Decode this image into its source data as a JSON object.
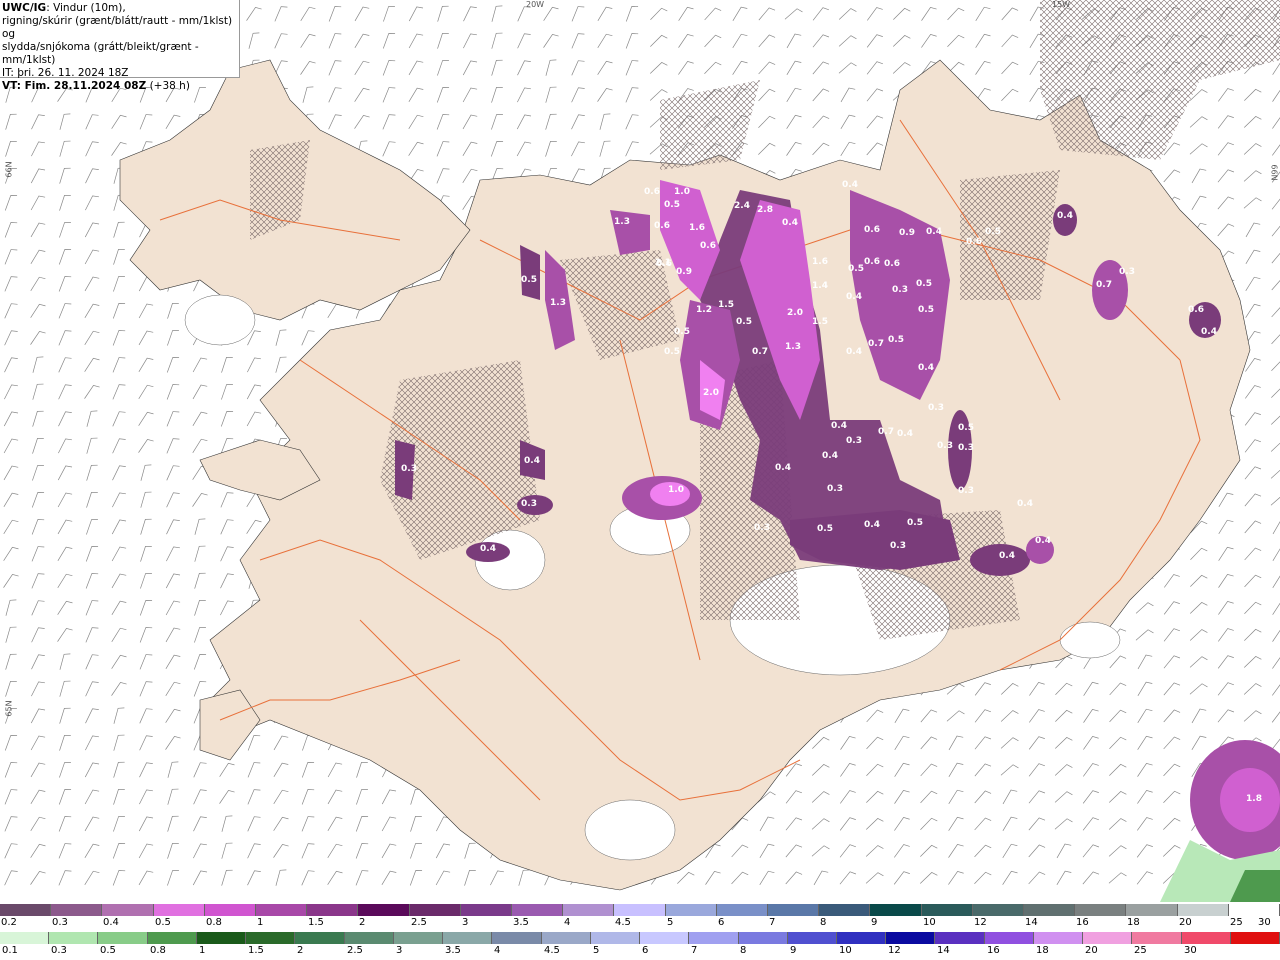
{
  "header": {
    "model": "UWC/IG",
    "line1": ": Vindur (10m),",
    "line2": "rigning/skúrir (grænt/blátt/rautt - mm/1klst) og",
    "line3": "slydda/snjókoma (grátt/bleikt/grænt - mm/1klst)",
    "it": "IT: þri. 26. 11. 2024 18Z",
    "vt_label": "VT: Fim. 28.11.2024 08Z",
    "vt_offset": " (+38 h)"
  },
  "grid_labels": {
    "lon_20w": "20W",
    "lon_15w": "15W",
    "lat_66n_left": "66N",
    "lat_66n_right": "66N",
    "lat_65n": "65N"
  },
  "map_values": [
    "0.6",
    "0.5",
    "1.3",
    "0.6",
    "1.0",
    "1.6",
    "0.6",
    "2.1",
    "0.9",
    "2.4",
    "2.8",
    "0.4",
    "0.4",
    "0.6",
    "0.9",
    "0.6",
    "0.5",
    "0.4",
    "1.6",
    "1.4",
    "0.5",
    "0.6",
    "0.6",
    "0.5",
    "0.3",
    "0.5",
    "1.3",
    "1.2",
    "1.5",
    "0.5",
    "2.0",
    "1.5",
    "0.4",
    "0.5",
    "0.5",
    "0.6",
    "0.4",
    "0.7",
    "0.5",
    "1.3",
    "0.7",
    "0.4",
    "0.5",
    "2.0",
    "0.5",
    "0.3",
    "0.4",
    "0.7",
    "0.4",
    "0.3",
    "0.4",
    "0.4",
    "0.3",
    "0.4",
    "0.3",
    "0.3",
    "1.0",
    "0.3",
    "0.3",
    "0.4",
    "0.3",
    "0.5",
    "0.4",
    "0.5",
    "0.4",
    "0.4",
    "0.4",
    "0.3",
    "1.8",
    "0.6",
    "0.4",
    "0.4",
    "0.3",
    "0.7",
    "0.3"
  ],
  "colors": {
    "sea": "#ffffff",
    "land": "#f2e2d2",
    "roads": "#e8703a",
    "snow_light": "#a850a8",
    "snow_mid": "#d060d0",
    "snow_high": "#f080f0",
    "snow_dark": "#7a3c7a",
    "rain_green": "#b8e8b8"
  },
  "colorbar_snow": {
    "colors": [
      "#6a4a6a",
      "#8c5a8c",
      "#b070b0",
      "#e070e0",
      "#d055d0",
      "#a848a8",
      "#8a368a",
      "#5a0a5a",
      "#6a2a6a",
      "#7a3a8a",
      "#9a5ab0",
      "#b090d0",
      "#c8c0ff",
      "#9aa8dc",
      "#7a90c8",
      "#5a78a8",
      "#3a5a7a",
      "#0a4a4a",
      "#2a5a5a",
      "#4a6a6a",
      "#607070",
      "#7a8080",
      "#9aa0a0",
      "#c8d0d0",
      "#ffffff"
    ],
    "ticks": [
      "0.2",
      "0.3",
      "0.4",
      "0.5",
      "0.8",
      "1",
      "1.5",
      "2",
      "2.5",
      "3",
      "3.5",
      "4",
      "4.5",
      "5",
      "6",
      "7",
      "8",
      "9",
      "10",
      "12",
      "14",
      "16",
      "18",
      "20",
      "25",
      "30"
    ]
  },
  "colorbar_rain": {
    "colors": [
      "#d8f5d8",
      "#b0e6b0",
      "#88cc88",
      "#4e9a4e",
      "#1a5a1a",
      "#2a6a2a",
      "#3a7a50",
      "#5a8a70",
      "#7aa090",
      "#8aa8a8",
      "#7a8aa8",
      "#9aa8c8",
      "#b0b8e8",
      "#c8c8ff",
      "#a0a0f0",
      "#7a7ae0",
      "#5050d0",
      "#3030c0",
      "#0a0aa0",
      "#5a30c0",
      "#9050e0",
      "#d090f0",
      "#f0a0e0",
      "#f07aa0",
      "#f04a6a",
      "#e01010"
    ],
    "ticks": [
      "0.1",
      "0.3",
      "0.5",
      "0.8",
      "1",
      "1.5",
      "2",
      "2.5",
      "3",
      "3.5",
      "4",
      "4.5",
      "5",
      "6",
      "7",
      "8",
      "9",
      "10",
      "12",
      "14",
      "16",
      "18",
      "20",
      "25",
      "30"
    ]
  }
}
